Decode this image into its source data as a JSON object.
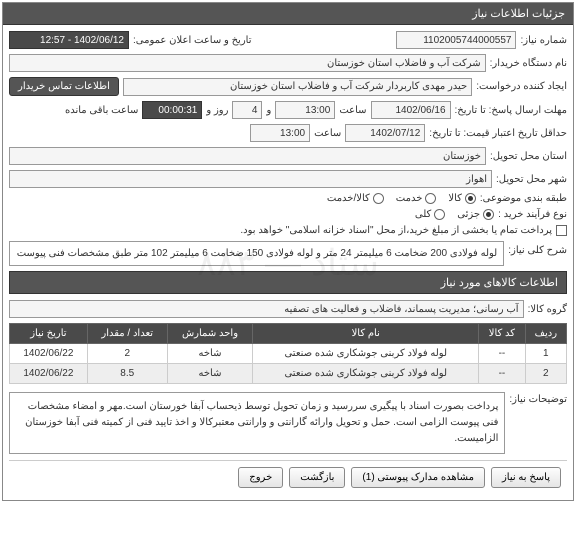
{
  "panel_title": "جزئیات اطلاعات نیاز",
  "labels": {
    "need_no": "شماره نیاز:",
    "announce_date": "تاریخ و ساعت اعلان عمومی:",
    "buyer_name": "نام دستگاه خریدار:",
    "requester": "ایجاد کننده درخواست:",
    "contact_badge": "اطلاعات تماس خریدار",
    "deadline": "مهلت ارسال پاسخ: تا تاریخ:",
    "hour": "ساعت",
    "and": "و",
    "days": "روز و",
    "remaining": "ساعت باقی مانده",
    "validity": "حداقل تاریخ اعتبار قیمت: تا تاریخ:",
    "province": "استان محل تحویل:",
    "city": "شهر محل تحویل:",
    "classification": "طبقه بندی موضوعی:",
    "process_type": "نوع فرآیند خرید :",
    "payment_note": "پرداخت تمام یا بخشی از مبلغ خرید،از محل \"اسناد خزانه اسلامی\" خواهد بود.",
    "desc_title": "شرح کلی نیاز:",
    "items_title": "اطلاعات کالاهای مورد نیاز",
    "group": "گروه کالا:",
    "notes": "توضیحات نیاز:"
  },
  "values": {
    "need_no": "1102005744000557",
    "announce_date": "1402/06/12 - 12:57",
    "buyer_name": "شرکت آب و فاضلاب استان خوزستان",
    "requester": "حیدر مهدی کاربردار شرکت آب و فاضلاب استان خوزستان",
    "deadline_date": "1402/06/16",
    "deadline_time": "13:00",
    "days_left": "4",
    "time_left": "00:00:31",
    "validity_date": "1402/07/12",
    "validity_time": "13:00",
    "province": "خوزستان",
    "city": "اهواز",
    "description": "لوله فولادی 200 ضخامت 6 میلیمتر 24 متر و لوله فولادی 150 ضخامت 6 میلیمتر 102 متر طبق مشخصات فنی پیوست",
    "group": "آب رسانی؛ مدیریت پسماند، فاضلاب و فعالیت های تصفیه",
    "notes": "پرداخت بصورت اسناد با پیگیری  سررسید و زمان تحویل توسط ذیحساب آبفا خورستان است.مهر و امضاء مشخصات فنی پیوست الزامی است.   حمل و تحویل وارائه گارانتی و وارانتی معتبرکالا و اخذ تایید فنی از کمیته فنی آبفا خوزستان الزامیست."
  },
  "radios": {
    "goods": "کالا",
    "service": "خدمت",
    "both": "کالا/خدمت",
    "partial": "جزئی",
    "total": "کلی"
  },
  "table": {
    "headers": {
      "row": "ردیف",
      "code": "کد کالا",
      "name": "نام کالا",
      "unit": "واحد شمارش",
      "qty": "تعداد / مقدار",
      "date": "تاریخ نیاز"
    },
    "rows": [
      {
        "row": "1",
        "code": "--",
        "name": "لوله فولاد کربنی جوشکاری شده صنعتی",
        "unit": "شاخه",
        "qty": "2",
        "date": "1402/06/22"
      },
      {
        "row": "2",
        "code": "--",
        "name": "لوله فولاد کربنی جوشکاری شده صنعتی",
        "unit": "شاخه",
        "qty": "8.5",
        "date": "1402/06/22"
      }
    ]
  },
  "buttons": {
    "respond": "پاسخ به نیاز",
    "attachments": "مشاهده مدارک پیوستی (1)",
    "back": "بازگشت",
    "exit": "خروج"
  },
  "watermark": "ستاد — ۸۸۳"
}
